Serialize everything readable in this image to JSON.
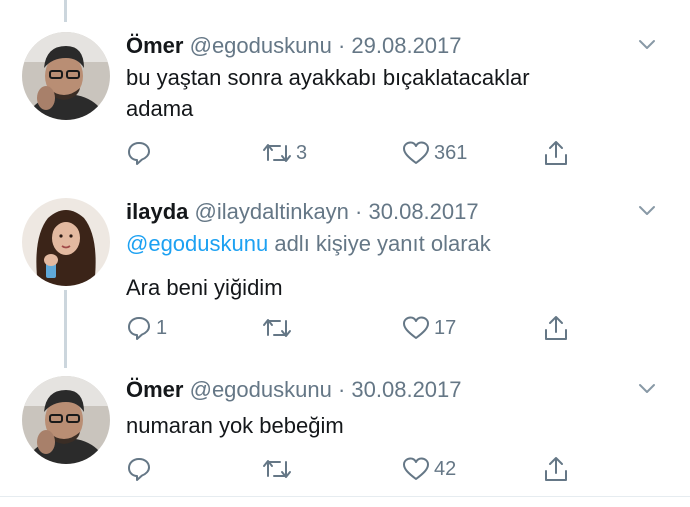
{
  "tweets": [
    {
      "name": "Ömer",
      "handle": "@egoduskunu",
      "separator": "·",
      "date": "29.08.2017",
      "reply_to": null,
      "text": "bu yaştan sonra ayakkabı bıçaklatacaklar\nadama",
      "replies": "",
      "retweets": "3",
      "likes": "361"
    },
    {
      "name": "ilayda",
      "handle": "@ilaydaltinkayn",
      "separator": "·",
      "date": "30.08.2017",
      "reply_to": {
        "mention": "@egoduskunu",
        "suffix": " adlı kişiye yanıt olarak"
      },
      "text": "Ara beni yiğidim",
      "replies": "1",
      "retweets": "",
      "likes": "17"
    },
    {
      "name": "Ömer",
      "handle": "@egoduskunu",
      "separator": "·",
      "date": "30.08.2017",
      "reply_to": null,
      "text": "numaran yok bebeğim",
      "replies": "",
      "retweets": "",
      "likes": "42"
    }
  ],
  "icons": {
    "reply": "reply-icon",
    "retweet": "retweet-icon",
    "like": "heart-icon",
    "share": "share-icon",
    "more": "chevron-down-icon"
  },
  "colors": {
    "text": "#14171a",
    "secondary": "#657786",
    "link": "#1da1f2",
    "thread_line": "#ccd6dd"
  }
}
